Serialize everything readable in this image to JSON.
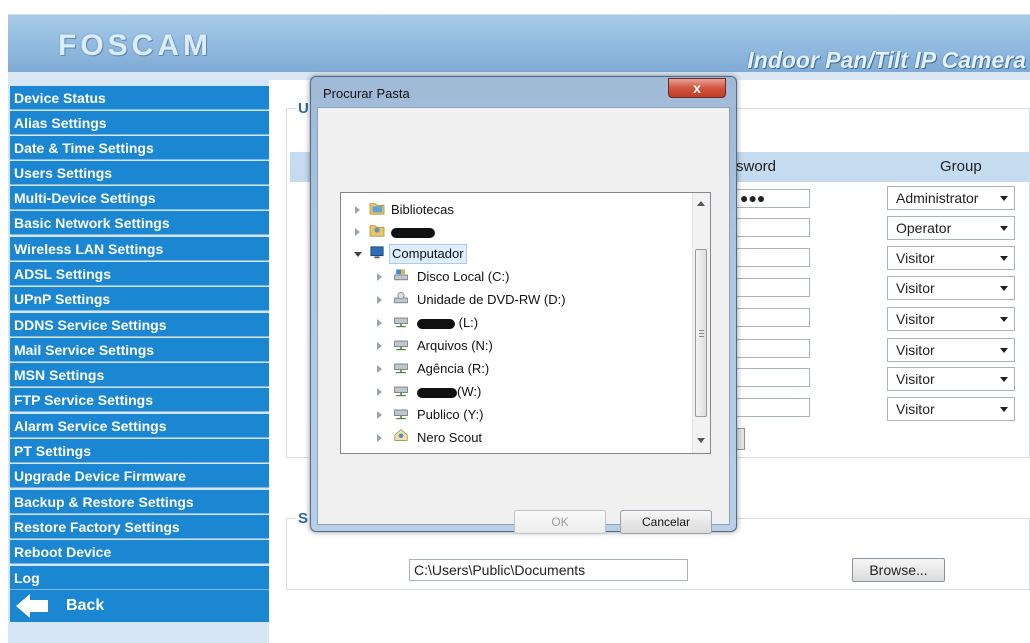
{
  "header": {
    "logo": "FOSCAM",
    "product": "Indoor Pan/Tilt IP Camera"
  },
  "sidebar": {
    "items": [
      "Device Status",
      "Alias Settings",
      "Date & Time Settings",
      "Users Settings",
      "Multi-Device Settings",
      "Basic Network Settings",
      "Wireless LAN Settings",
      "ADSL Settings",
      "UPnP Settings",
      "DDNS Service Settings",
      "Mail Service Settings",
      "MSN Settings",
      "FTP Service Settings",
      "Alarm Service Settings",
      "PT Settings",
      "Upgrade Device Firmware",
      "Backup & Restore Settings",
      "Restore Factory Settings",
      "Reboot Device",
      "Log"
    ],
    "back_label": "Back"
  },
  "main": {
    "users_legend_partial": "U",
    "section2_legend_partial": "S",
    "columns": {
      "password_partial": "sword",
      "group": "Group"
    },
    "password_mask": "●●●",
    "groups": [
      "Administrator",
      "Operator",
      "Visitor",
      "Visitor",
      "Visitor",
      "Visitor",
      "Visitor",
      "Visitor"
    ],
    "path_value": "C:\\Users\\Public\\Documents",
    "browse_label": "Browse..."
  },
  "dialog": {
    "title": "Procurar Pasta",
    "close_label": "x",
    "ok_label": "OK",
    "cancel_label": "Cancelar",
    "tree": {
      "bibliotecas": "Bibliotecas",
      "computador": "Computador",
      "disco_local": "Disco Local (C:)",
      "dvd": "Unidade de DVD-RW (D:)",
      "drive_l": "(L:)",
      "arquivos": "Arquivos (N:)",
      "agencia": "Agência (R:)",
      "drive_w": "(W:)",
      "publico": "Publico (Y:)",
      "nero": "Nero Scout"
    }
  },
  "colors": {
    "nav_bg": "#1b86d2",
    "header_bg": "#8fb8de",
    "dialog_frame": "#adc6e1",
    "close_red": "#c03b25"
  },
  "icons": [
    "library-folder-icon",
    "user-folder-icon",
    "computer-icon",
    "local-disk-icon",
    "dvd-drive-icon",
    "network-drive-icon",
    "nero-scout-icon",
    "back-arrow-icon",
    "dropdown-arrow-icon"
  ]
}
